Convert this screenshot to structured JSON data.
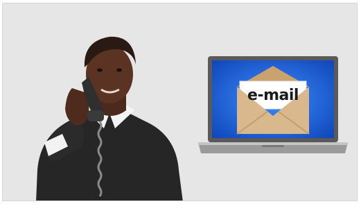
{
  "scene": {
    "email_word": "e-mail",
    "colors": {
      "background": "#e6e6e6",
      "screen_blue": "#1f63d8",
      "envelope": "#d8b88c",
      "sweater": "#262626",
      "laptop_body": "#6e6e6e"
    },
    "icons": [
      "telephone-handset-icon",
      "envelope-icon",
      "laptop-icon"
    ]
  }
}
